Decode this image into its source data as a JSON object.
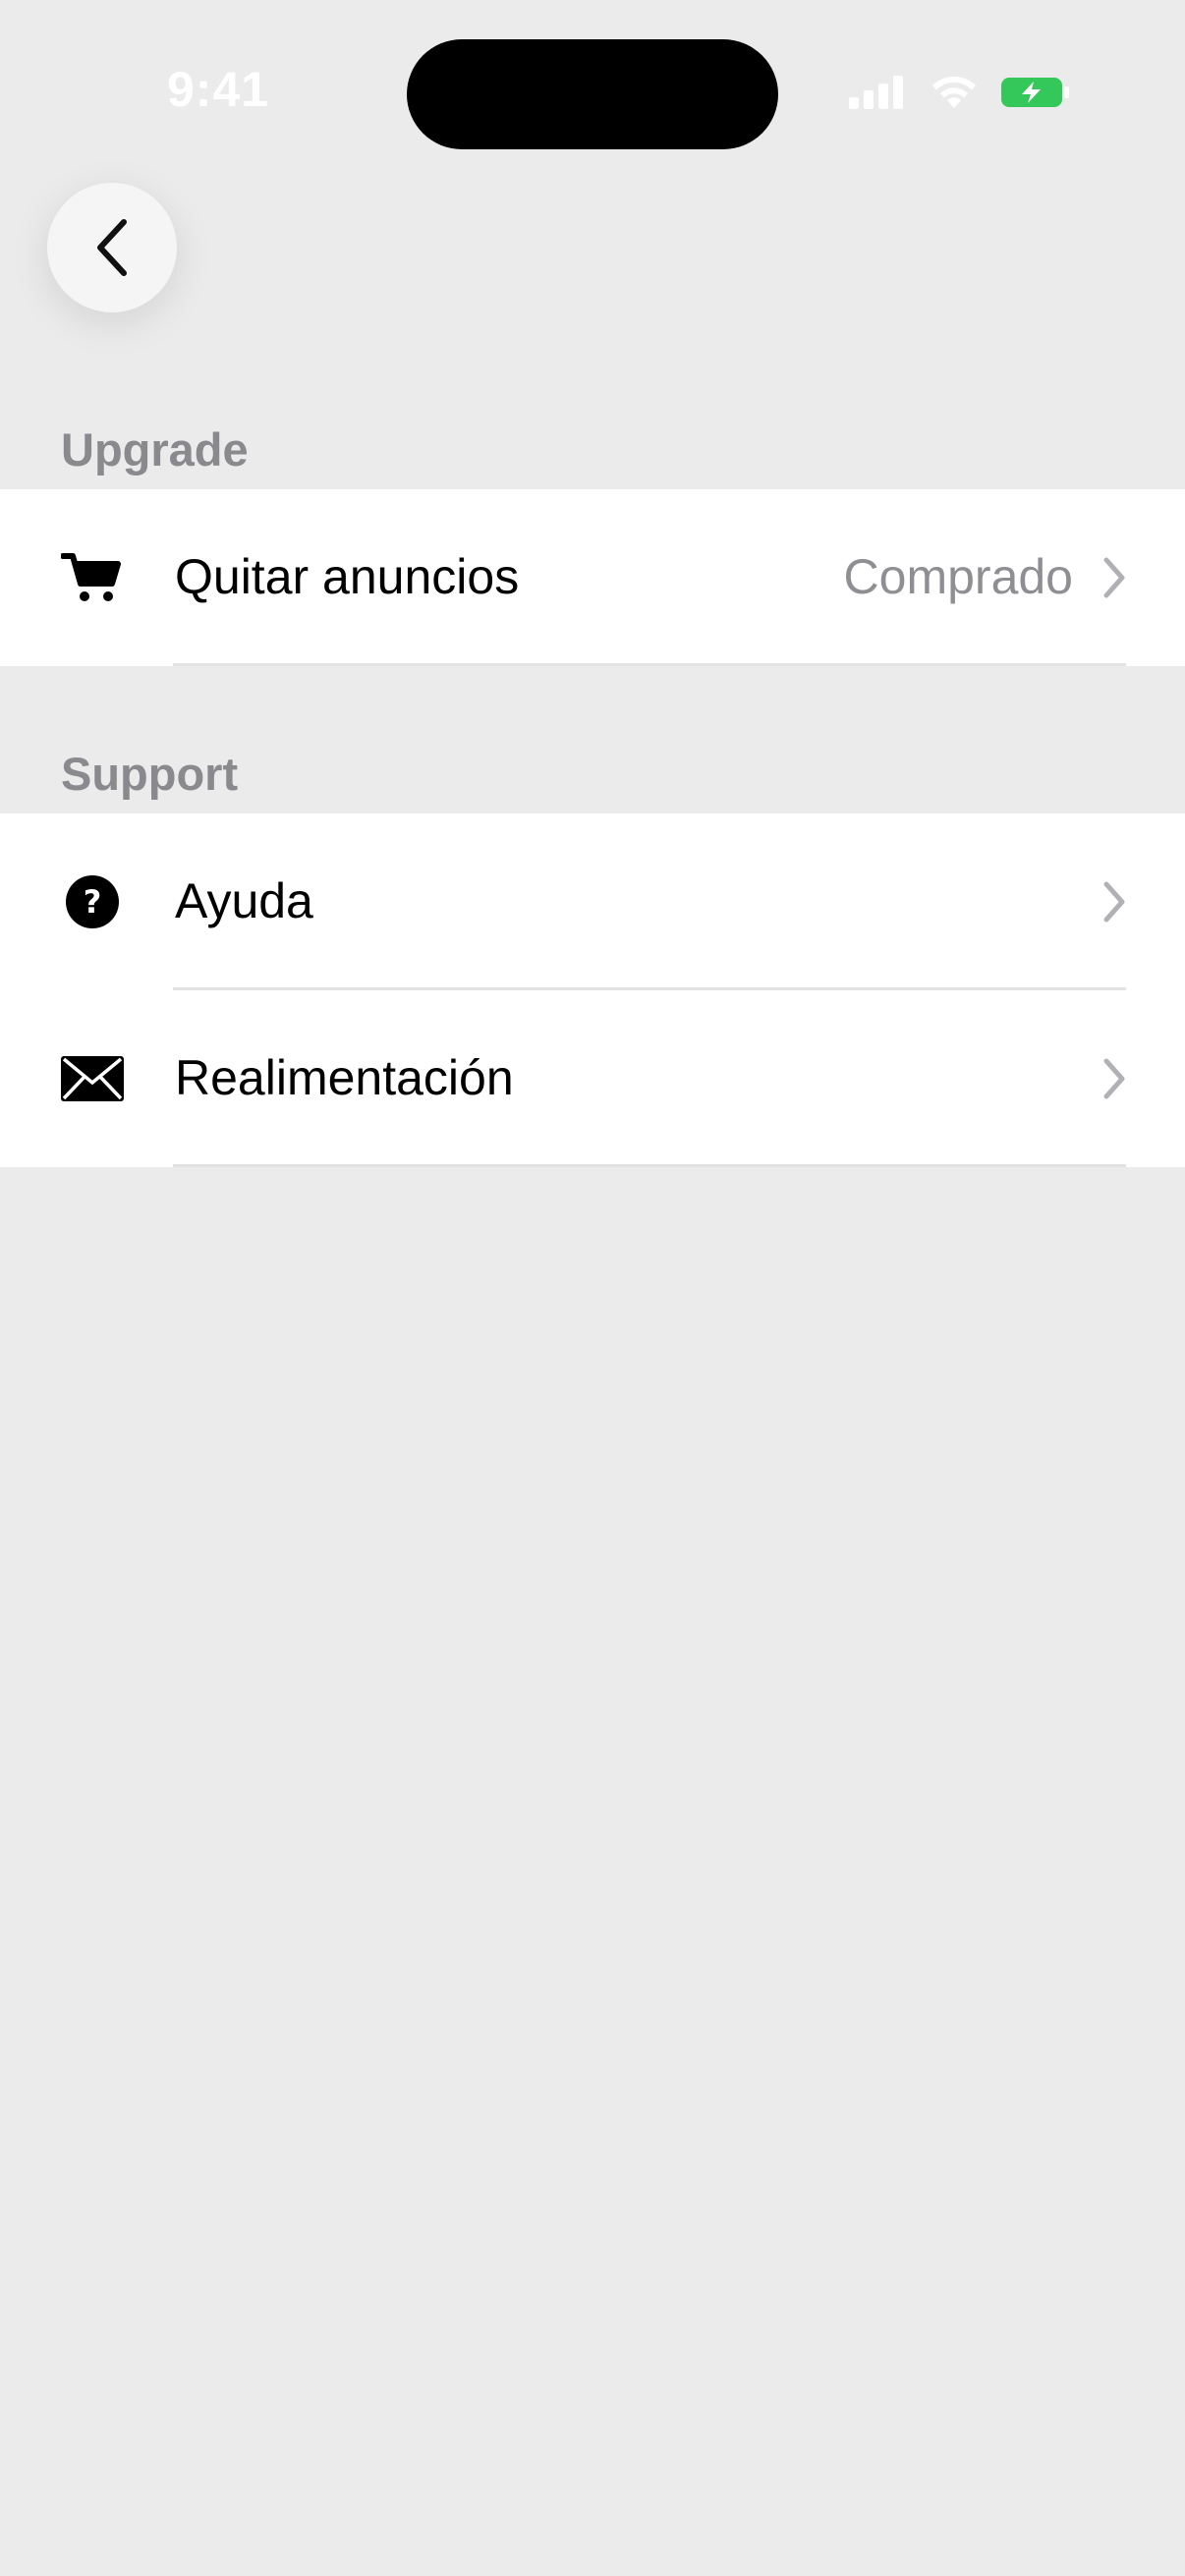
{
  "status_bar": {
    "time": "9:41"
  },
  "nav": {
    "back_icon": "chevron-left-icon"
  },
  "sections": {
    "upgrade": {
      "header": "Upgrade",
      "rows": [
        {
          "icon": "cart-icon",
          "label": "Quitar anuncios",
          "value": "Comprado"
        }
      ]
    },
    "support": {
      "header": "Support",
      "rows": [
        {
          "icon": "help-icon",
          "label": "Ayuda"
        },
        {
          "icon": "envelope-icon",
          "label": "Realimentación"
        }
      ]
    }
  },
  "colors": {
    "background": "#ebebeb",
    "row_background": "#ffffff",
    "secondary_text": "#8e8e93",
    "battery_green": "#34c759"
  }
}
